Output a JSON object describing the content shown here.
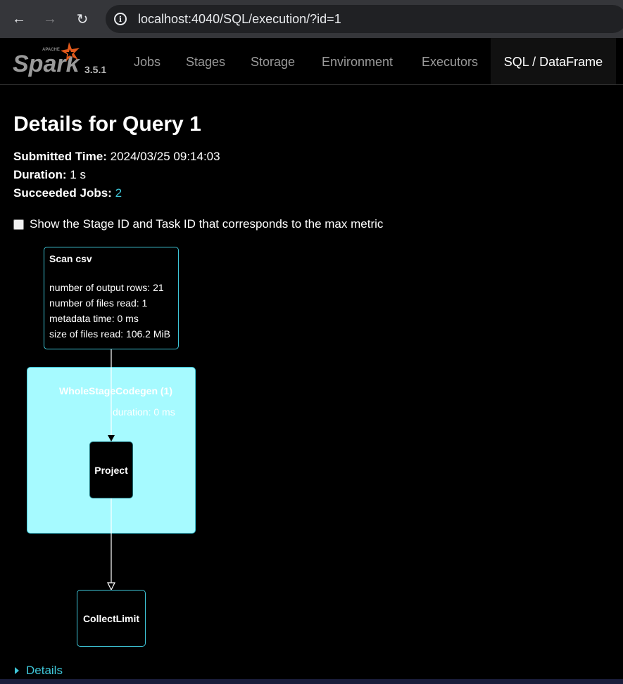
{
  "browser": {
    "url": "localhost:4040/SQL/execution/?id=1"
  },
  "navbar": {
    "version": "3.5.1",
    "tabs": [
      {
        "label": "Jobs"
      },
      {
        "label": "Stages"
      },
      {
        "label": "Storage"
      },
      {
        "label": "Environment"
      },
      {
        "label": "Executors"
      },
      {
        "label": "SQL / DataFrame",
        "active": true
      }
    ]
  },
  "page": {
    "title": "Details for Query 1",
    "submitted_label": "Submitted Time:",
    "submitted_value": "2024/03/25 09:14:03",
    "duration_label": "Duration:",
    "duration_value": "1 s",
    "jobs_label": "Succeeded Jobs:",
    "jobs_value": "2",
    "checkbox_label": "Show the Stage ID and Task ID that corresponds to the max metric",
    "details_label": "Details"
  },
  "graph": {
    "scan": {
      "title": "Scan csv",
      "metrics": [
        "number of output rows: 21",
        "number of files read: 1",
        "metadata time: 0 ms",
        "size of files read: 106.2 MiB"
      ]
    },
    "cluster": {
      "title": "WholeStageCodegen (1)",
      "duration": "duration: 0 ms"
    },
    "project": {
      "title": "Project"
    },
    "collect": {
      "title": "CollectLimit"
    }
  },
  "colors": {
    "accent": "#3ec6d8",
    "cluster_fill": "#a6faff",
    "background": "#000000"
  }
}
